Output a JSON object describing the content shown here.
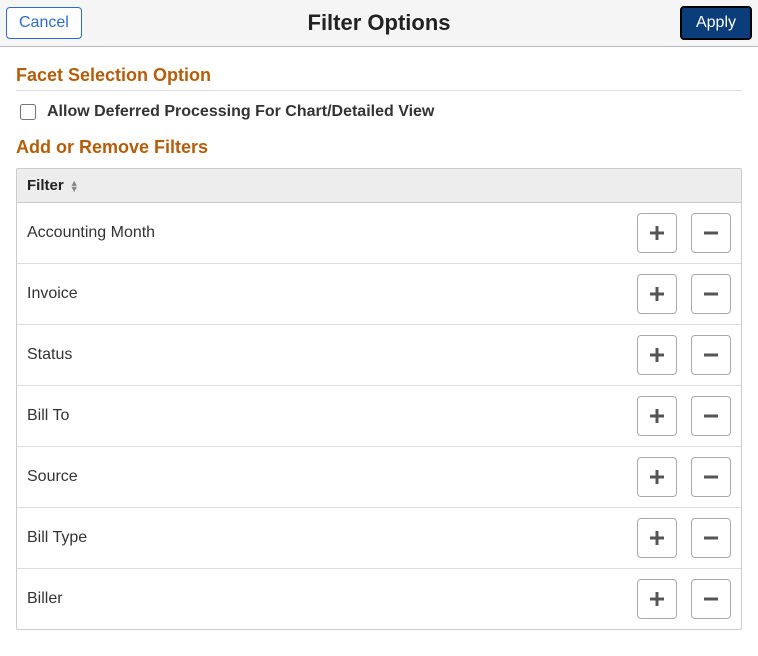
{
  "header": {
    "cancel_label": "Cancel",
    "title": "Filter Options",
    "apply_label": "Apply"
  },
  "facet_section": {
    "heading": "Facet Selection Option",
    "checkbox_label": "Allow Deferred Processing For Chart/Detailed View",
    "checkbox_checked": false
  },
  "filters_section": {
    "heading": "Add or Remove Filters",
    "column_header": "Filter",
    "rows": [
      {
        "name": "Accounting Month"
      },
      {
        "name": "Invoice"
      },
      {
        "name": "Status"
      },
      {
        "name": "Bill To"
      },
      {
        "name": "Source"
      },
      {
        "name": "Bill Type"
      },
      {
        "name": "Biller"
      }
    ]
  }
}
